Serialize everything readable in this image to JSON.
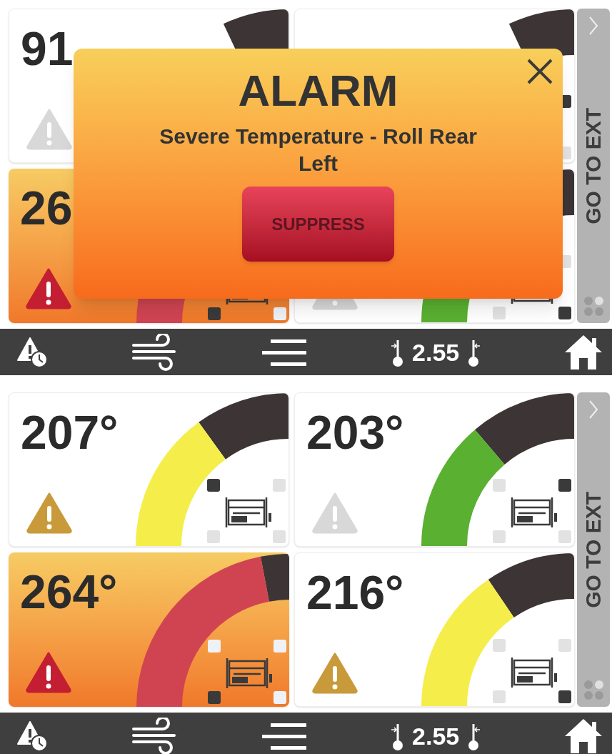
{
  "screens": [
    {
      "cards": [
        {
          "value": "91",
          "kind": "normal",
          "alert_icon": {
            "kind": "normal"
          }
        },
        {
          "kind": "normal",
          "corners": {
            "top_right": {
              "active": true
            },
            "bottom_right": {
              "active": false
            }
          }
        },
        {
          "value": "26",
          "kind": "alarm",
          "alert_icon": {
            "kind": "alarm"
          },
          "level": 0.88,
          "color": "#d04452",
          "corners": {
            "bottom_left": {
              "active": true
            },
            "bottom_right": {
              "active": false
            }
          }
        },
        {
          "kind": "normal",
          "alert_icon": {
            "kind": "normal"
          },
          "level": 0.55,
          "color": "#5ab031",
          "corners": {
            "top_right": {
              "active": false
            },
            "bottom_left": {
              "active": false
            },
            "bottom_right": {
              "active": true
            }
          }
        }
      ],
      "alarm_popup": {
        "title": "ALARM",
        "message": "Severe Temperature - Roll Rear Left",
        "button": "SUPPRESS"
      },
      "side_panel": {
        "label": "GO TO EXT",
        "pages": [
          {
            "selected": false
          },
          {
            "selected": true
          },
          {
            "selected": false
          },
          {
            "selected": false
          }
        ]
      },
      "nav_bar": {
        "gap_reading": "2.55"
      }
    },
    {
      "cards": [
        {
          "value": "207°",
          "kind": "warning",
          "alert_icon": {
            "kind": "warning"
          },
          "level": 0.6,
          "color": "#f5ee4a",
          "corners": {
            "top_left": {
              "active": true
            },
            "top_right": {
              "active": false
            },
            "bottom_left": {
              "active": false
            },
            "bottom_right": {
              "active": false
            }
          }
        },
        {
          "value": "203°",
          "kind": "normal",
          "alert_icon": {
            "kind": "normal"
          },
          "level": 0.55,
          "color": "#5ab031",
          "corners": {
            "top_left": {
              "active": false
            },
            "top_right": {
              "active": true
            },
            "bottom_left": {
              "active": false
            },
            "bottom_right": {
              "active": false
            }
          }
        },
        {
          "value": "264°",
          "kind": "alarm",
          "alert_icon": {
            "kind": "alarm"
          },
          "level": 0.88,
          "color": "#d04452",
          "corners": {
            "top_left": {
              "active": false
            },
            "top_right": {
              "active": false
            },
            "bottom_left": {
              "active": true
            },
            "bottom_right": {
              "active": false
            }
          }
        },
        {
          "value": "216°",
          "kind": "warning",
          "alert_icon": {
            "kind": "warning"
          },
          "level": 0.62,
          "color": "#f5ee4a",
          "corners": {
            "top_left": {
              "active": false
            },
            "top_right": {
              "active": false
            },
            "bottom_left": {
              "active": false
            },
            "bottom_right": {
              "active": true
            }
          }
        }
      ],
      "side_panel": {
        "label": "GO TO EXT",
        "pages": [
          {
            "selected": false
          },
          {
            "selected": true
          },
          {
            "selected": false
          },
          {
            "selected": false
          }
        ]
      },
      "nav_bar": {
        "gap_reading": "2.55"
      }
    }
  ]
}
